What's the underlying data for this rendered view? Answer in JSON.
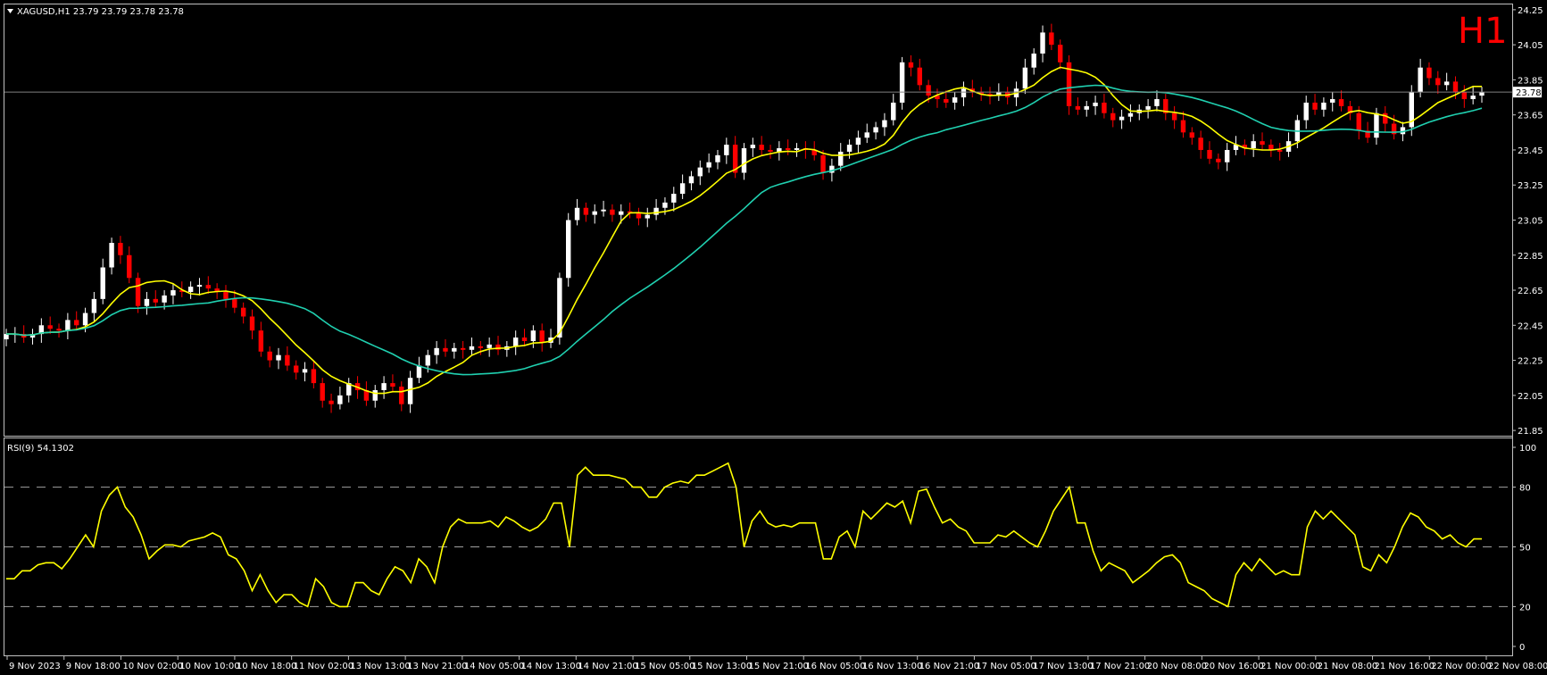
{
  "header": {
    "symbol_line": "XAGUSD,H1  23.79 23.79 23.78 23.78",
    "timeframe_badge": "H1",
    "rsi_label": "RSI(9) 54.1302"
  },
  "colors": {
    "background": "#000000",
    "frame": "#c0c0c0",
    "bull_candle": "#ffffff",
    "bear_candle": "#ff0000",
    "ma_fast": "#ffff00",
    "ma_slow": "#20d0b0",
    "rsi_line": "#ffff00",
    "price_line": "#808080",
    "badge": "#ff0000"
  },
  "chart_data": [
    {
      "type": "candlestick",
      "symbol": "XAGUSD",
      "timeframe": "H1",
      "last_price": "23.78",
      "ylim": [
        21.82,
        24.28
      ],
      "y_ticks": [
        "24.25",
        "24.05",
        "23.85",
        "23.65",
        "23.45",
        "23.25",
        "23.05",
        "22.85",
        "22.65",
        "22.45",
        "22.25",
        "22.05",
        "21.85"
      ],
      "x_ticks": [
        "9 Nov 2023",
        "9 Nov 18:00",
        "10 Nov 02:00",
        "10 Nov 10:00",
        "10 Nov 18:00",
        "11 Nov 02:00",
        "13 Nov 13:00",
        "13 Nov 21:00",
        "14 Nov 05:00",
        "14 Nov 13:00",
        "14 Nov 21:00",
        "15 Nov 05:00",
        "15 Nov 13:00",
        "15 Nov 21:00",
        "16 Nov 05:00",
        "16 Nov 13:00",
        "16 Nov 21:00",
        "17 Nov 05:00",
        "17 Nov 13:00",
        "17 Nov 21:00",
        "20 Nov 08:00",
        "20 Nov 16:00",
        "21 Nov 00:00",
        "21 Nov 08:00",
        "21 Nov 16:00",
        "22 Nov 00:00",
        "22 Nov 08:00"
      ],
      "close": [
        22.4,
        22.4,
        22.38,
        22.4,
        22.45,
        22.43,
        22.42,
        22.48,
        22.45,
        22.52,
        22.6,
        22.78,
        22.92,
        22.85,
        22.72,
        22.56,
        22.6,
        22.58,
        22.62,
        22.65,
        22.64,
        22.67,
        22.68,
        22.66,
        22.64,
        22.6,
        22.55,
        22.5,
        22.42,
        22.3,
        22.25,
        22.28,
        22.22,
        22.18,
        22.2,
        22.12,
        22.02,
        22.0,
        22.05,
        22.12,
        22.08,
        22.02,
        22.08,
        22.12,
        22.1,
        22.0,
        22.15,
        22.22,
        22.28,
        22.32,
        22.3,
        22.32,
        22.31,
        22.33,
        22.32,
        22.34,
        22.31,
        22.33,
        22.38,
        22.36,
        22.42,
        22.35,
        22.38,
        22.72,
        23.05,
        23.12,
        23.08,
        23.1,
        23.11,
        23.08,
        23.1,
        23.09,
        23.06,
        23.08,
        23.12,
        23.15,
        23.2,
        23.26,
        23.3,
        23.35,
        23.38,
        23.42,
        23.48,
        23.32,
        23.46,
        23.48,
        23.45,
        23.44,
        23.46,
        23.45,
        23.46,
        23.45,
        23.42,
        23.32,
        23.36,
        23.44,
        23.48,
        23.52,
        23.55,
        23.58,
        23.62,
        23.72,
        23.95,
        23.92,
        23.82,
        23.76,
        23.74,
        23.72,
        23.75,
        23.8,
        23.78,
        23.77,
        23.76,
        23.78,
        23.75,
        23.8,
        23.92,
        24.0,
        24.12,
        24.05,
        23.95,
        23.7,
        23.68,
        23.7,
        23.72,
        23.66,
        23.62,
        23.64,
        23.66,
        23.68,
        23.7,
        23.74,
        23.66,
        23.62,
        23.55,
        23.52,
        23.45,
        23.4,
        23.38,
        23.45,
        23.48,
        23.46,
        23.5,
        23.48,
        23.45,
        23.44,
        23.5,
        23.62,
        23.72,
        23.68,
        23.72,
        23.74,
        23.7,
        23.66,
        23.56,
        23.52,
        23.66,
        23.6,
        23.54,
        23.58,
        23.78,
        23.92,
        23.86,
        23.82,
        23.84,
        23.78,
        23.74,
        23.76,
        23.78
      ],
      "rsi": {
        "label": "RSI(9)",
        "last_value": 54.1302,
        "ylim": [
          0,
          100
        ],
        "y_ticks": [
          100,
          80,
          50,
          20,
          0
        ],
        "levels": [
          80,
          50,
          20
        ],
        "values": [
          34,
          34,
          38,
          38,
          41,
          42,
          42,
          39,
          44,
          50,
          56,
          50,
          68,
          76,
          80,
          70,
          65,
          56,
          44,
          48,
          51,
          51,
          50,
          53,
          54,
          55,
          57,
          55,
          46,
          44,
          38,
          28,
          36,
          28,
          22,
          26,
          26,
          22,
          20,
          34,
          30,
          22,
          20,
          20,
          32,
          32,
          28,
          26,
          34,
          40,
          38,
          32,
          44,
          40,
          32,
          50,
          60,
          64,
          62,
          62,
          62,
          63,
          60,
          65,
          63,
          60,
          58,
          60,
          64,
          72,
          72,
          50,
          86,
          90,
          86,
          86,
          86,
          85,
          84,
          80,
          80,
          75,
          75,
          80,
          82,
          83,
          82,
          86,
          86,
          88,
          90,
          92,
          80,
          50,
          63,
          68,
          62,
          60,
          61,
          60,
          62,
          62,
          62,
          44,
          44,
          55,
          58,
          50,
          68,
          64,
          68,
          72,
          70,
          73,
          62,
          78,
          79,
          70,
          62,
          64,
          60,
          58,
          52,
          52,
          52,
          56,
          55,
          58,
          55,
          52,
          50,
          58,
          68,
          74,
          80,
          62,
          62,
          48,
          38,
          42,
          40,
          38,
          32,
          35,
          38,
          42,
          45,
          46,
          42,
          32,
          30,
          28,
          24,
          22,
          20,
          36,
          42,
          38,
          44,
          40,
          36,
          38,
          36,
          36,
          60,
          68,
          64,
          68,
          64,
          60,
          56,
          40,
          38,
          46,
          42,
          50,
          60,
          67,
          65,
          60,
          58,
          54,
          56,
          52,
          50,
          54,
          54
        ]
      }
    }
  ]
}
